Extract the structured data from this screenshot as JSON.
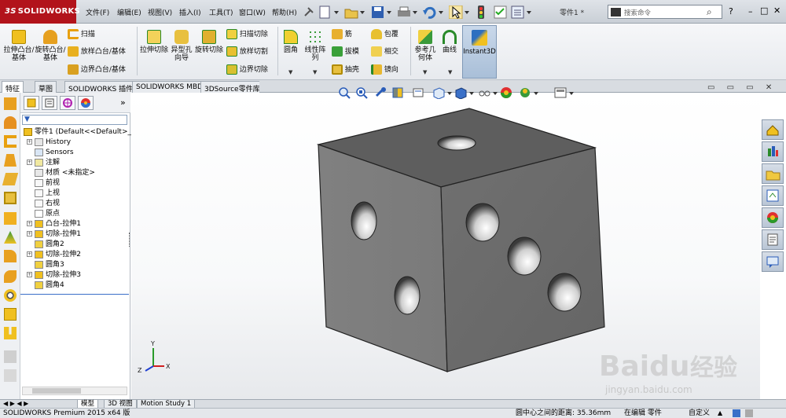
{
  "app": {
    "logo_prefix": "3S",
    "logo_name": "SOLIDWORKS",
    "doc_name": "零件1 *"
  },
  "menu": [
    "文件(F)",
    "编辑(E)",
    "视图(V)",
    "插入(I)",
    "工具(T)",
    "窗口(W)",
    "帮助(H)"
  ],
  "search": {
    "placeholder": "搜索命令"
  },
  "ribbon": {
    "extrude_boss": "拉伸凸台/基体",
    "revolve_boss": "旋转凸台/基体",
    "sweep": "扫描",
    "loft_boss": "放样凸台/基体",
    "boundary_boss": "边界凸台/基体",
    "extrude_cut": "拉伸切除",
    "hole_wizard": "异型孔向导",
    "revolve_cut": "旋转切除",
    "swept_cut": "扫描切除",
    "lofted_cut": "放样切割",
    "boundary_cut": "边界切除",
    "fillet": "圆角",
    "linear_pattern": "线性阵列",
    "rib": "筋",
    "draft": "拔模",
    "shell": "抽壳",
    "wrap": "包覆",
    "intersect": "相交",
    "mirror": "镜向",
    "ref_geometry": "参考几何体",
    "curves": "曲线",
    "instant3d": "Instant3D"
  },
  "tabs": [
    "特征",
    "草图",
    "SOLIDWORKS 插件",
    "SOLIDWORKS MBD",
    "3DSource零件库"
  ],
  "tree": {
    "root": "零件1  (Default<<Default>_P",
    "items": [
      {
        "label": "History",
        "expandable": true
      },
      {
        "label": "Sensors",
        "expandable": false
      },
      {
        "label": "注解",
        "expandable": true
      },
      {
        "label": "材质 <未指定>",
        "expandable": false
      },
      {
        "label": "前视",
        "expandable": false
      },
      {
        "label": "上视",
        "expandable": false
      },
      {
        "label": "右视",
        "expandable": false
      },
      {
        "label": "原点",
        "expandable": false
      },
      {
        "label": "凸台-拉伸1",
        "expandable": true
      },
      {
        "label": "切除-拉伸1",
        "expandable": true
      },
      {
        "label": "圆角2",
        "expandable": false
      },
      {
        "label": "切除-拉伸2",
        "expandable": true
      },
      {
        "label": "圆角3",
        "expandable": false
      },
      {
        "label": "切除-拉伸3",
        "expandable": true
      },
      {
        "label": "圆角4",
        "expandable": false
      }
    ]
  },
  "triad": {
    "x": "X",
    "y": "Y",
    "z": "Z"
  },
  "bottom_tabs": [
    "模型",
    "3D 视图",
    "Motion Study 1"
  ],
  "status": {
    "product": "SOLIDWORKS Premium 2015 x64 版",
    "distance": "圆中心之间的距离: 35.36mm",
    "editing": "在编辑 零件",
    "custom": "自定义"
  },
  "watermark": {
    "brand": "Baidu",
    "cn": "经验",
    "url": "jingyan.baidu.com"
  },
  "colors": {
    "brand_red": "#b2131b",
    "cube_right": "#6c6c6c",
    "cube_left": "#7d7d7d",
    "cube_top": "#5c5c5c"
  }
}
